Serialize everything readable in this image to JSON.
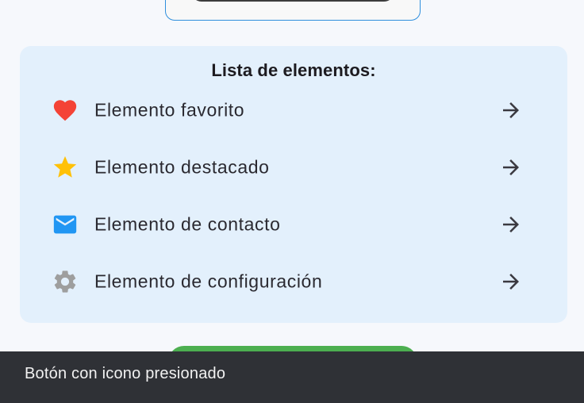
{
  "list": {
    "title": "Lista de elementos:",
    "items": [
      {
        "label": "Elemento favorito",
        "icon": "heart-icon",
        "icon_color": "#f44336"
      },
      {
        "label": "Elemento destacado",
        "icon": "star-icon",
        "icon_color": "#ffc107"
      },
      {
        "label": "Elemento de contacto",
        "icon": "email-icon",
        "icon_color": "#2196f3"
      },
      {
        "label": "Elemento de configuración",
        "icon": "gear-icon",
        "icon_color": "#9e9e9e"
      }
    ],
    "trailing_icon": "arrow-forward-icon"
  },
  "snackbar": {
    "message": "Botón con icono presionado"
  },
  "colors": {
    "accent": "#2f8fdd",
    "panel_bg": "#e3f0fc",
    "button_green": "#4caf50",
    "snackbar_bg": "#2f3136"
  }
}
